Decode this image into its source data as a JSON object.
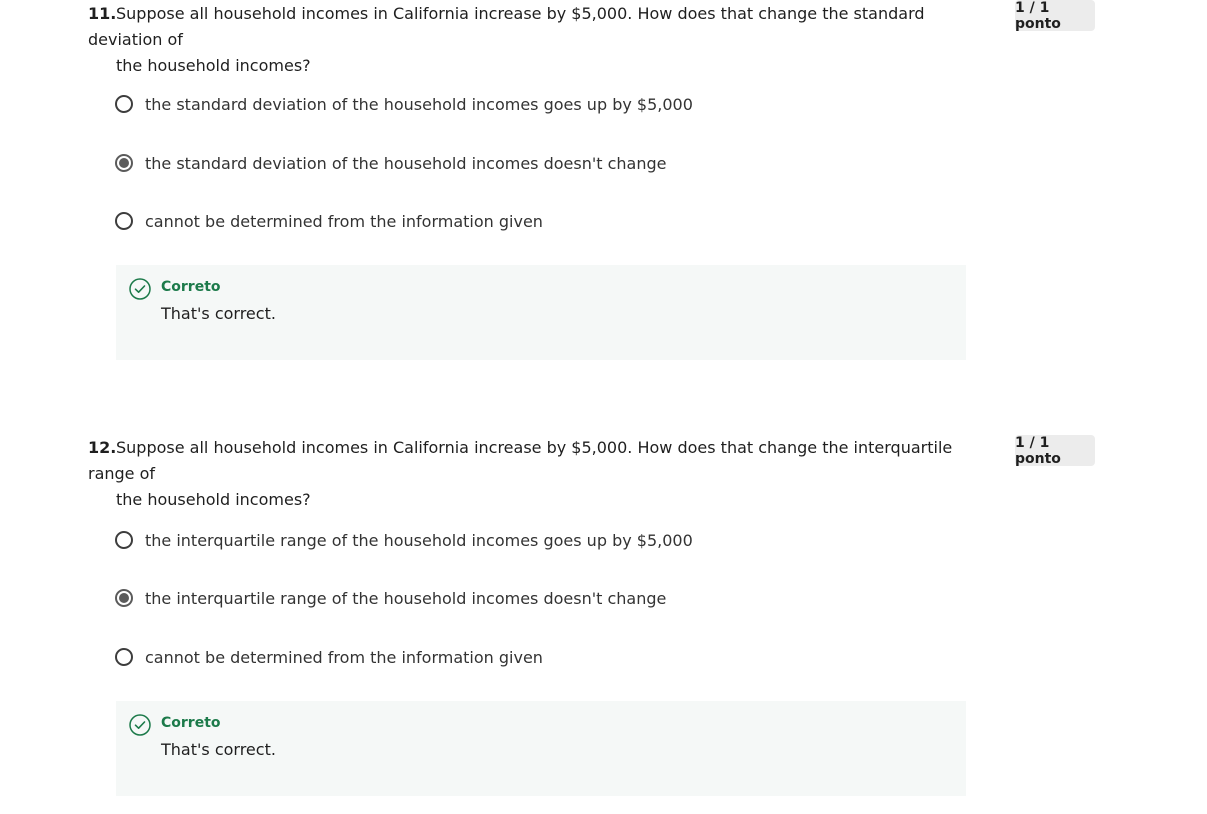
{
  "questions": [
    {
      "number": "11.",
      "text_line1": "Suppose all household incomes in California increase by $5,000. How does that change the standard deviation of",
      "text_line2": "the household incomes?",
      "points": "1 / 1 ponto",
      "options": [
        {
          "label": "the standard deviation of the household incomes goes up by $5,000",
          "selected": false
        },
        {
          "label": "the standard deviation of the household incomes doesn't change",
          "selected": true
        },
        {
          "label": "cannot be determined from the information given",
          "selected": false
        }
      ],
      "feedback": {
        "title": "Correto",
        "text": "That's correct."
      }
    },
    {
      "number": "12.",
      "text_line1": "Suppose all household incomes in California increase by $5,000. How does that change the interquartile range of",
      "text_line2": "the household incomes?",
      "points": "1 / 1 ponto",
      "options": [
        {
          "label": "the interquartile range of the household incomes goes up by $5,000",
          "selected": false
        },
        {
          "label": "the interquartile range of the household incomes doesn't change",
          "selected": true
        },
        {
          "label": "cannot be determined from the information given",
          "selected": false
        }
      ],
      "feedback": {
        "title": "Correto",
        "text": "That's correct."
      }
    }
  ],
  "colors": {
    "correct_green": "#1c7a4a",
    "feedback_bg": "#f5f8f7",
    "badge_bg": "#ececec"
  },
  "icons": {
    "feedback": "check-circle-icon"
  }
}
